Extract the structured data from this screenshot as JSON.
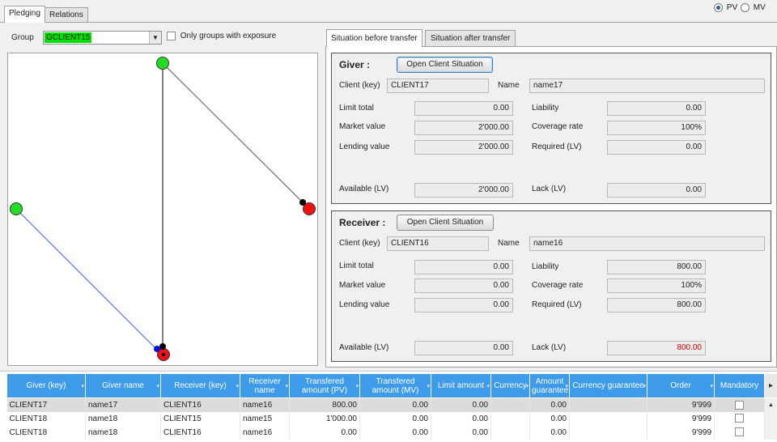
{
  "tabs": {
    "pledging": "Pledging",
    "relations": "Relations"
  },
  "mode": {
    "pv_label": "PV",
    "mv_label": "MV",
    "selected": "PV"
  },
  "group": {
    "label": "Group",
    "value": "GCLIENT15",
    "highlight_color": "#00e000",
    "exposure_label": "Only groups with exposure"
  },
  "situation_tabs": {
    "before": "Situation before transfer",
    "after": "Situation after transfer"
  },
  "giver": {
    "title": "Giver :",
    "open_button": "Open Client Situation",
    "client_key_label": "Client (key)",
    "client_key": "CLIENT17",
    "name_label": "Name",
    "name": "name17",
    "limit_total_label": "Limit total",
    "limit_total": "0.00",
    "market_value_label": "Market value",
    "market_value": "2'000.00",
    "lending_value_label": "Lending value",
    "lending_value": "2'000.00",
    "available_label": "Available (LV)",
    "available": "2'000.00",
    "liability_label": "Liability",
    "liability": "0.00",
    "coverage_rate_label": "Coverage rate",
    "coverage_rate": "100%",
    "required_label": "Required (LV)",
    "required": "0.00",
    "lack_label": "Lack (LV)",
    "lack": "0.00"
  },
  "receiver": {
    "title": "Receiver :",
    "open_button": "Open Client Situation",
    "client_key_label": "Client (key)",
    "client_key": "CLIENT16",
    "name_label": "Name",
    "name": "name16",
    "limit_total_label": "Limit total",
    "limit_total": "0.00",
    "market_value_label": "Market value",
    "market_value": "0.00",
    "lending_value_label": "Lending value",
    "lending_value": "0.00",
    "available_label": "Available (LV)",
    "available": "0.00",
    "liability_label": "Liability",
    "liability": "800.00",
    "coverage_rate_label": "Coverage rate",
    "coverage_rate": "100%",
    "required_label": "Required (LV)",
    "required": "800.00",
    "lack_label": "Lack (LV)",
    "lack": "800.00",
    "lack_color": "#d00000"
  },
  "graph_colors": {
    "green": "#22dd22",
    "red": "#ee1111",
    "blue": "#1010dd",
    "black": "#000000",
    "blue_line": "#4a5fd8"
  },
  "table": {
    "columns": [
      "Giver (key)",
      "Giver name",
      "Receiver (key)",
      "Receiver name",
      "Transfered amount (PV)",
      "Transfered amount (MV)",
      "Limit amount",
      "Currency",
      "Amount guarantee",
      "Currency guarantee",
      "Order",
      "Mandatory"
    ],
    "rows": [
      [
        "CLIENT17",
        "name17",
        "CLIENT16",
        "name16",
        "800.00",
        "0.00",
        "0.00",
        "",
        "0.00",
        "",
        "9'999",
        ""
      ],
      [
        "CLIENT18",
        "name18",
        "CLIENT15",
        "name15",
        "1'000.00",
        "0.00",
        "0.00",
        "",
        "0.00",
        "",
        "9'999",
        ""
      ],
      [
        "CLIENT18",
        "name18",
        "CLIENT16",
        "name16",
        "0.00",
        "0.00",
        "0.00",
        "",
        "0.00",
        "",
        "9'999",
        ""
      ]
    ]
  }
}
